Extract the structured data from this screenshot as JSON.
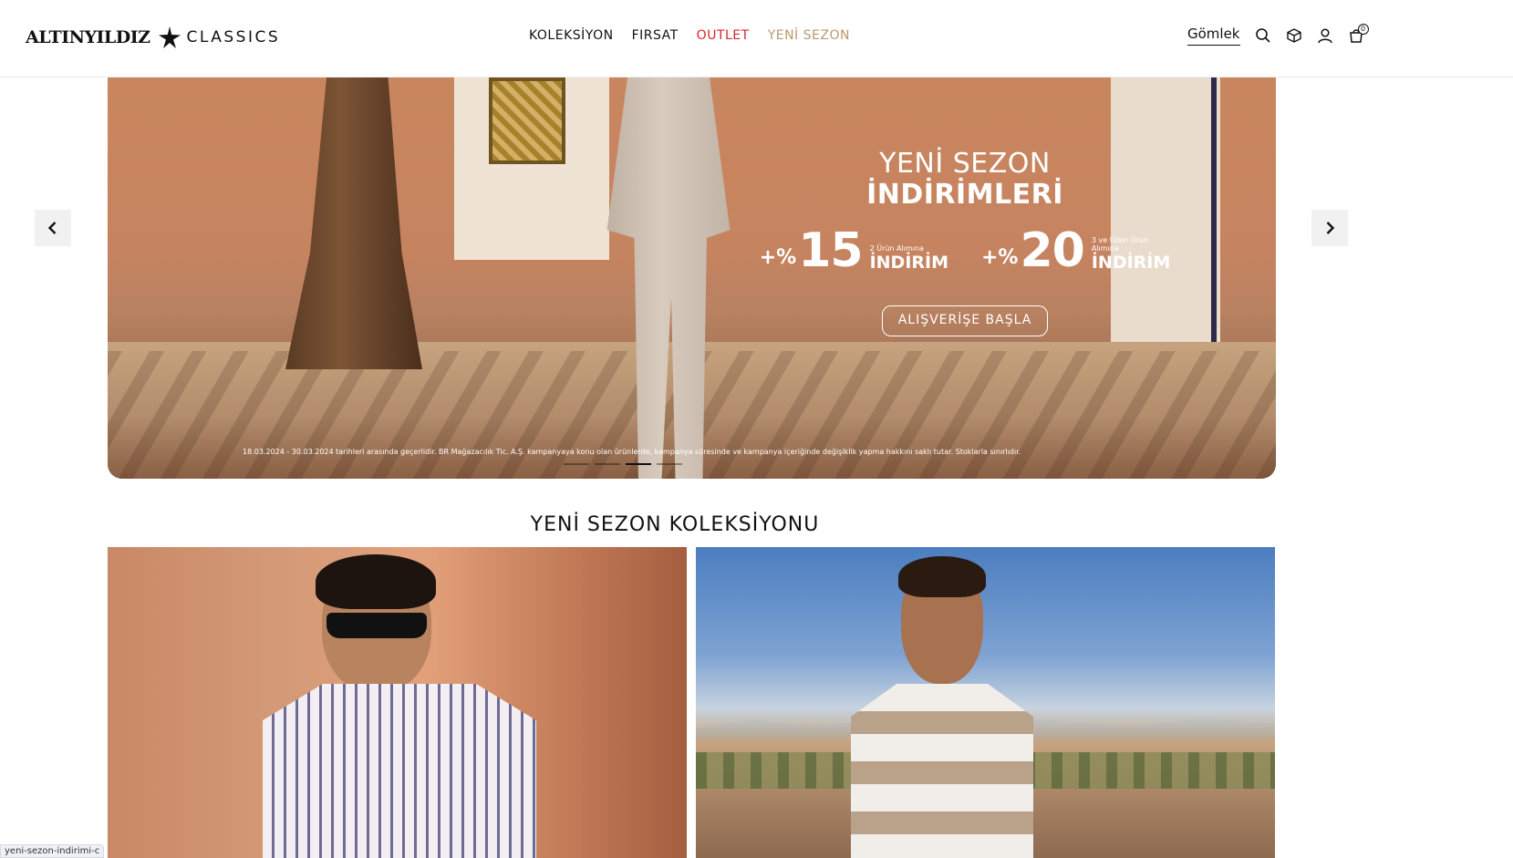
{
  "brand": {
    "name": "ALTINYILDIZ",
    "sub": "CLASSICS"
  },
  "nav": {
    "items": [
      {
        "label": "KOLEKSİYON"
      },
      {
        "label": "FIRSAT"
      },
      {
        "label": "OUTLET",
        "color": "#d6262e"
      },
      {
        "label": "YENİ SEZON",
        "color": "#b89a6a"
      }
    ]
  },
  "header": {
    "search_term": "Gömlek",
    "cart_count": "0"
  },
  "hero": {
    "title_line1": "YENİ SEZON",
    "title_line2": "İNDİRİMLERİ",
    "offers": [
      {
        "prefix": "+%",
        "value": "15",
        "note": "2 Ürün Alımına",
        "label": "İNDİRİM"
      },
      {
        "prefix": "+%",
        "value": "20",
        "note": "3 ve Üzeri Ürün Alımına",
        "label": "İNDİRİM"
      }
    ],
    "cta": "ALIŞVERİŞE BAŞLA",
    "disclaimer": "18.03.2024 - 30.03.2024 tarihleri arasında geçerlidir. BR Mağazacılık Tic. A.Ş. kampanyaya konu olan ürünlerde, kampanya süresinde ve kampanya içeriğinde değişiklik yapma hakkını saklı tutar. Stoklarla sınırlıdır."
  },
  "collection": {
    "title": "YENİ SEZON KOLEKSİYONU"
  },
  "status_bar": {
    "url": "yeni-sezon-indirimi-c"
  }
}
